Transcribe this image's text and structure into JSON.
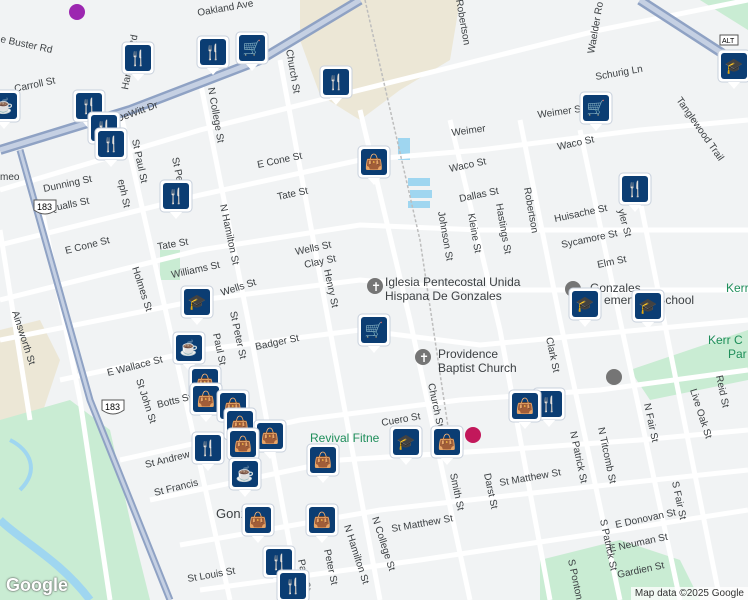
{
  "map": {
    "labels": {
      "oakland_ave": "Oakland Ave",
      "buster_rd": "e Buster Rd",
      "carroll_st": "Carroll St",
      "h_dewitt_dr": "h DeWitt Dr",
      "harwood_rd": "Harwood Rd",
      "n_college_st": "N College St",
      "church_st": "Church St",
      "e_cone_st": "E Cone St",
      "e_cone_st_w": "E Cone St",
      "tate_st": "Tate St",
      "tate_st_w": "Tate St",
      "dunning_st": "Dunning St",
      "qualls_st": "Qualls St",
      "st_paul_st": "St Paul St",
      "st_joseph": "eph St",
      "st_peter": "St Pe",
      "n_hamilton_st": "N Hamilton St",
      "wells_st": "Wells St",
      "wells_st_w": "Wells St",
      "clay_st": "Clay St",
      "williams_st": "Williams St",
      "henry_st": "Henry St",
      "holmes_st": "Holmes St",
      "ainsworth_st": "Ainsworth St",
      "st_peter_st": "St Peter St",
      "paul_st": "Paul St",
      "badger_st": "Badger St",
      "e_wallace_st": "E Wallace St",
      "st_john_st": "St John St",
      "botts_st": "Botts St",
      "st_andrew": "St Andrew",
      "st_francis": "St Francis",
      "cuero_st": "Cuero St",
      "church_st_s": "Church St",
      "smith_st": "Smith St",
      "darst_st": "Darst St",
      "st_matthew_st": "St Matthew St",
      "st_matthew_st_w": "St Matthew St",
      "n_patrick_st": "N Patrick St",
      "n_titcomb_st": "N Titcomb St",
      "s_patrick_st": "S Patrick St",
      "s_fair_st": "S Fair St",
      "n_fair_st": "N Fair St",
      "live_oak_st": "Live Oak St",
      "reid_st": "Reid St",
      "e_donovan_st": "E Donovan St",
      "e_neuman_st": "E Neuman St",
      "gardien_st": "Gardien St",
      "s_ponton": "S Ponton",
      "st_louis_st": "St Louis St",
      "n_college_st_s": "N College St",
      "n_hamilton_st_s": "N Hamilton St",
      "peter_st": "Peter St",
      "paul_st_s": "Paul St",
      "robertson": "Robertson",
      "robertson2": "Robertson",
      "johnson_st": "Johnson St",
      "kleine_st": "Kleine St",
      "hastings_st": "Hastings St",
      "waco_st": "Waco St",
      "waco_st2": "Waco St",
      "dallas_st": "Dallas St",
      "weimer": "Weimer",
      "weimer2": "Weimer St",
      "schurig_ln": "Schurig Ln",
      "tanglewood": "Tanglewood Trail",
      "waelder_rd": "Waelder Ro",
      "huisache_st": "Huisache St",
      "sycamore_st": "Sycamore St",
      "elm_st": "Elm St",
      "clark_st": "Clark St",
      "tyler_st": "yler St",
      "kerr_c": "Kerr C",
      "kerr_c_par": "Par",
      "kerr": "Kerr",
      "e_cone_st_west": "E Cone St",
      "amo": "meo",
      "gonzales_short": "Gonzales"
    },
    "pois": {
      "iglesia": "Iglesia Pentecostal Unida",
      "iglesia2": "Hispana De Gonzales",
      "providence": "Providence",
      "providence2": "Baptist Church",
      "revival": "Revival Fitne",
      "gonzales_school": "Gonzales",
      "gonzales_school2": "ementary School"
    },
    "shields": {
      "us183_a": "183",
      "us183_b": "183",
      "alt": "ALT"
    },
    "footer": {
      "google": "Google",
      "attribution": "Map data ©2025 Google"
    },
    "colors": {
      "land": "#f1f3f4",
      "road": "#ffffff",
      "highway": "#8fa2c4",
      "green": "#c9ecd3",
      "water": "#9fd6f0",
      "marker": "#0b3d73"
    }
  }
}
